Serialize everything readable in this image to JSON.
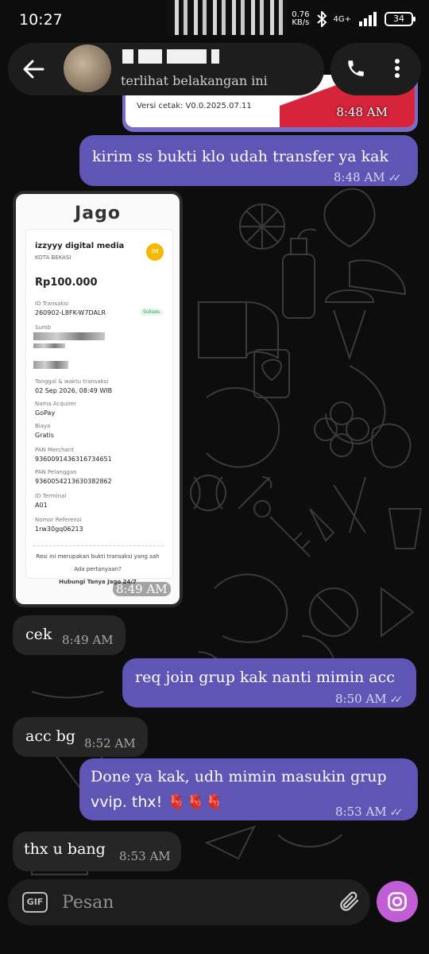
{
  "status_bar": {
    "time": "10:27",
    "net_speed_value": "0.76",
    "net_speed_unit": "KB/s",
    "network": "4G+",
    "battery": "34"
  },
  "header": {
    "subtitle": "terlihat belakangan ini"
  },
  "top_card": {
    "print_version": "Versi cetak: V0.0.2025.07.11",
    "time": "8:48 AM"
  },
  "messages": [
    {
      "direction": "outgoing",
      "lines": [
        "kirim ss bukti klo udah transfer ya kak"
      ],
      "time": "8:48 AM",
      "read": true
    },
    {
      "direction": "incoming",
      "type": "image",
      "time": "8:49 AM"
    },
    {
      "direction": "incoming",
      "lines": [
        "cek"
      ],
      "time": "8:49 AM"
    },
    {
      "direction": "outgoing",
      "lines": [
        "req join grup kak nanti mimin acc"
      ],
      "time": "8:50 AM",
      "read": true
    },
    {
      "direction": "incoming",
      "lines": [
        "acc bg"
      ],
      "time": "8:52 AM"
    },
    {
      "direction": "outgoing",
      "lines": [
        "Done ya kak, udh mimin masukin grup",
        "vvip. thx! 🫀🫀🫀"
      ],
      "time": "8:53 AM",
      "read": true
    },
    {
      "direction": "incoming",
      "lines": [
        "thx u bang"
      ],
      "time": "8:53 AM"
    }
  ],
  "receipt": {
    "logo": "Jago",
    "merchant": "izzyyy digital media",
    "city": "KOTA BEKASI",
    "badge": "IM",
    "amount": "Rp100.000",
    "tx_id_label": "ID Transaksi",
    "tx_id": "260902-L8FK-W7DALR",
    "status": "Sukses",
    "source_label": "Sumb",
    "datetime_label": "Tanggal & waktu transaksi",
    "datetime": "02 Sep 2026, 08:49 WIB",
    "acquirer_label": "Nama Acquirer",
    "acquirer": "GoPay",
    "fee_label": "Biaya",
    "fee": "Gratis",
    "pan_merchant_label": "PAN Merchant",
    "pan_merchant": "9360091436316734651",
    "pan_customer_label": "PAN Pelanggan",
    "pan_customer": "9360054213630382862",
    "terminal_label": "ID Terminal",
    "terminal": "A01",
    "ref_label": "Nomor Referensi",
    "ref": "1rw30gq06213",
    "footer_note": "Resi ini merupakan bukti transaksi yang sah",
    "footer_question": "Ada pertanyaan?",
    "footer_contact": "Hubungi Tanya Jago 24/7"
  },
  "composer": {
    "gif_label": "GIF",
    "placeholder": "Pesan"
  },
  "colors": {
    "outgoing_bubble": "#5e55b5",
    "incoming_bubble": "#262626",
    "camera_button": "#c15ed6",
    "background": "#0d0d0d"
  },
  "icons": [
    "back-arrow-icon",
    "phone-icon",
    "more-vert-icon",
    "gif-icon",
    "paperclip-icon",
    "camera-icon",
    "bluetooth-icon",
    "signal-icon",
    "double-check-icon"
  ]
}
